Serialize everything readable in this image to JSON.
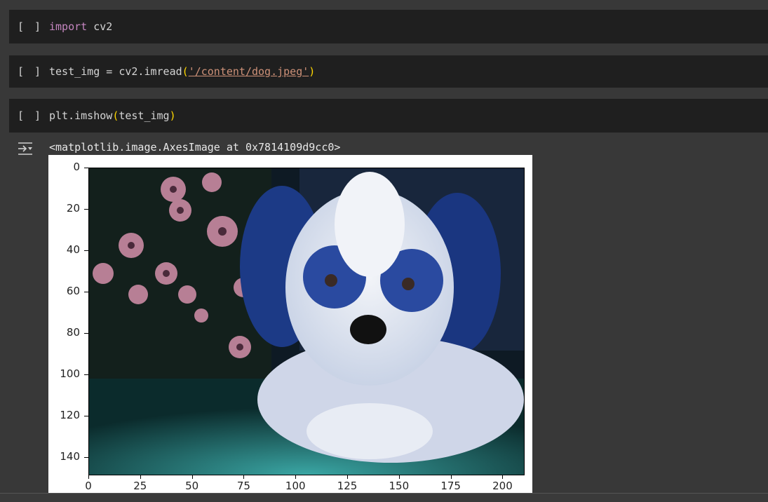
{
  "cells": [
    {
      "run_label": "[ ]",
      "tokens": [
        {
          "t": "import",
          "c": "kw"
        },
        {
          "t": " cv2",
          "c": ""
        }
      ]
    },
    {
      "run_label": "[ ]",
      "tokens": [
        {
          "t": "test_img = cv2.imread",
          "c": ""
        },
        {
          "t": "(",
          "c": "par"
        },
        {
          "t": "'/content/dog.jpeg'",
          "c": "str"
        },
        {
          "t": ")",
          "c": "par"
        }
      ]
    },
    {
      "run_label": "[ ]",
      "tokens": [
        {
          "t": "plt.imshow",
          "c": ""
        },
        {
          "t": "(",
          "c": "par"
        },
        {
          "t": "test_img",
          "c": ""
        },
        {
          "t": ")",
          "c": "par"
        }
      ]
    }
  ],
  "output": {
    "icon": "output-toggle-icon",
    "text": "<matplotlib.image.AxesImage at 0x7814109d9cc0>"
  },
  "plot": {
    "image_description_icon": "dog-photo-image",
    "yticks": [
      "0",
      "20",
      "40",
      "60",
      "80",
      "100",
      "120",
      "140"
    ],
    "xticks": [
      "0",
      "25",
      "50",
      "75",
      "100",
      "125",
      "150",
      "175",
      "200"
    ],
    "yrange": [
      0,
      148
    ],
    "xrange": [
      0,
      210
    ]
  },
  "colors": {
    "background": "#383838",
    "cell_bg": "#1f1f1f",
    "keyword": "#c586c0",
    "bracket": "#ffd700",
    "string": "#ce9178"
  }
}
